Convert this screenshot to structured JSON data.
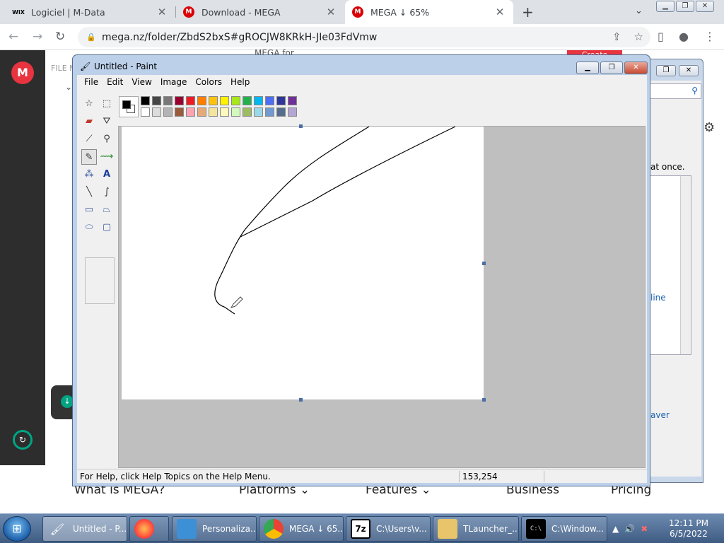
{
  "browser": {
    "tabs": [
      {
        "label": "Logiciel | M-Data",
        "icon": "wix-icon"
      },
      {
        "label": "Download - MEGA",
        "icon": "mega-icon"
      },
      {
        "label": "MEGA ↓ 65%",
        "icon": "mega-icon"
      }
    ],
    "url": "mega.nz/folder/ZbdS2bxS#gROCJW8KRkH-JIe03FdVmw"
  },
  "mega": {
    "logo": "M",
    "file_manager_label": "FILE M",
    "mega_for": "MEGA for",
    "create_button": "Create",
    "footer": {
      "what": "What is MEGA?",
      "platforms": "Platforms ⌄",
      "features": "Features ⌄",
      "business": "Business",
      "pricing": "Pricing"
    }
  },
  "background_window": {
    "text_at_once": "at once.",
    "link_line": "line",
    "link_saver": "aver"
  },
  "paint": {
    "title": "Untitled - Paint",
    "menus": [
      "File",
      "Edit",
      "View",
      "Image",
      "Colors",
      "Help"
    ],
    "status_help": "For Help, click Help Topics on the Help Menu.",
    "status_coords": "153,254",
    "palette_row1": [
      "#000000",
      "#464646",
      "#787878",
      "#990030",
      "#ed1c24",
      "#ff7e00",
      "#ffc20e",
      "#fff200",
      "#a8e61d",
      "#22b14c",
      "#00b7ef",
      "#4d6df3",
      "#2f3699",
      "#6f3198"
    ],
    "palette_row2": [
      "#ffffff",
      "#dcdcdc",
      "#b4b4b4",
      "#9c5a3c",
      "#ffa3b1",
      "#e5aa7a",
      "#f5e49c",
      "#fff9bd",
      "#d3f9bc",
      "#9dbb61",
      "#99d9ea",
      "#709ad1",
      "#546d8e",
      "#b5a5d5"
    ],
    "foreground_color": "#000000",
    "background_color": "#ffffff"
  },
  "taskbar": {
    "items": [
      {
        "label": "Untitled - P...",
        "icon": "paint-icon"
      },
      {
        "label": "",
        "icon": "firefox-icon"
      },
      {
        "label": "Personaliza...",
        "icon": "personalization-icon"
      },
      {
        "label": "MEGA ↓ 65...",
        "icon": "chrome-icon"
      },
      {
        "label": "C:\\Users\\v...",
        "icon": "7zip-icon"
      },
      {
        "label": "TLauncher_...",
        "icon": "folder-icon"
      },
      {
        "label": "C:\\Window...",
        "icon": "cmd-icon"
      }
    ],
    "time": "12:11 PM",
    "date": "6/5/2022"
  }
}
